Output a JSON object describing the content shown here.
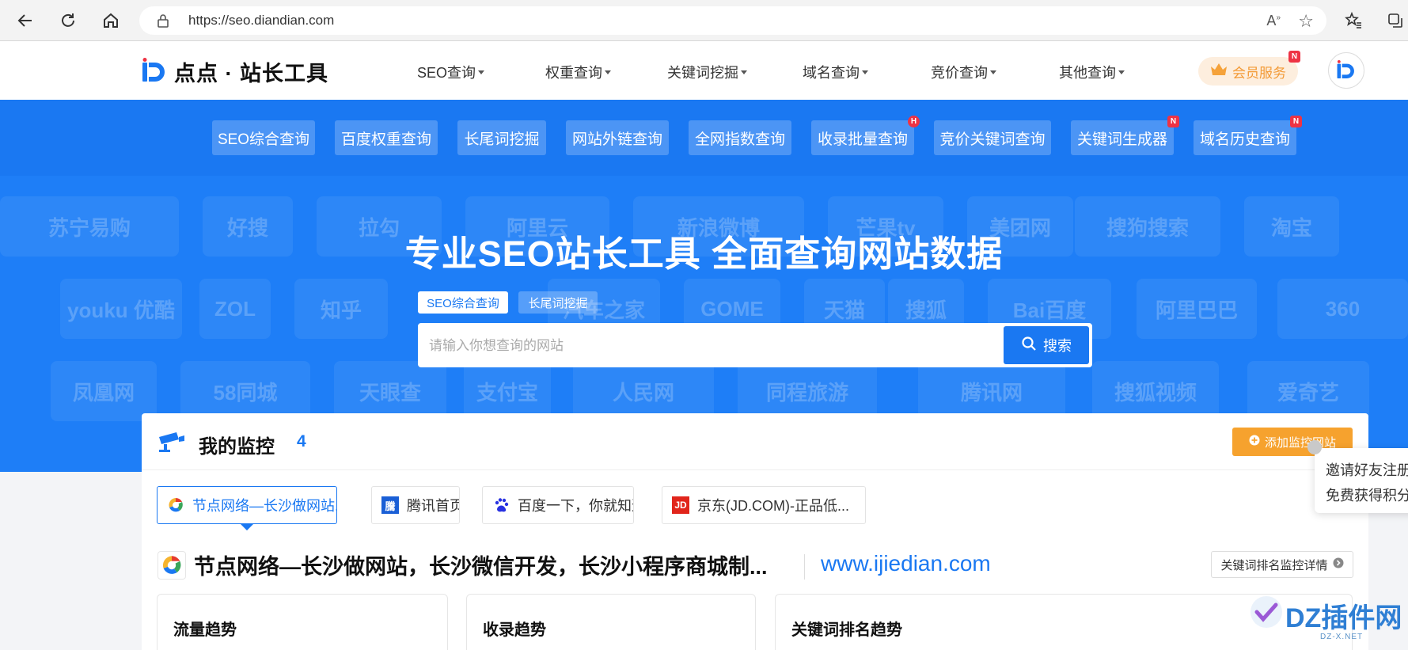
{
  "browser": {
    "url": "https://seo.diandian.com"
  },
  "header": {
    "logo_text": "点点 · 站长工具",
    "nav": [
      {
        "label": "SEO查询"
      },
      {
        "label": "权重查询"
      },
      {
        "label": "关键词挖掘"
      },
      {
        "label": "域名查询"
      },
      {
        "label": "竞价查询"
      },
      {
        "label": "其他查询"
      }
    ],
    "vip_label": "会员服务",
    "vip_badge": "N"
  },
  "quick_links": [
    {
      "label": "SEO综合查询",
      "badge": ""
    },
    {
      "label": "百度权重查询",
      "badge": ""
    },
    {
      "label": "长尾词挖掘",
      "badge": ""
    },
    {
      "label": "网站外链查询",
      "badge": ""
    },
    {
      "label": "全网指数查询",
      "badge": ""
    },
    {
      "label": "收录批量查询",
      "badge": "H"
    },
    {
      "label": "竞价关键词查询",
      "badge": ""
    },
    {
      "label": "关键词生成器",
      "badge": "N"
    },
    {
      "label": "域名历史查询",
      "badge": "N"
    }
  ],
  "background_logos": [
    "苏宁易购",
    "好搜",
    "拉勾",
    "阿里云",
    "新浪微博",
    "芒果tv",
    "美团网",
    "搜狗搜索",
    "淘宝",
    "youku 优酷",
    "ZOL",
    "知乎",
    "汽车之家",
    "GOME",
    "天猫",
    "搜狐",
    "Bai百度",
    "阿里巴巴",
    "360",
    "凤凰网",
    "58同城",
    "天眼查",
    "支付宝",
    "人民网",
    "同程旅游",
    "腾讯网",
    "搜狐视频",
    "爱奇艺"
  ],
  "hero": {
    "title": "专业SEO站长工具 全面查询网站数据",
    "tabs": [
      {
        "label": "SEO综合查询",
        "active": true
      },
      {
        "label": "长尾词挖掘",
        "active": false
      }
    ],
    "search_placeholder": "请输入你想查询的网站",
    "search_button": "搜索"
  },
  "monitor": {
    "title": "我的监控",
    "count": "4",
    "add_button": "添加监控网站",
    "sites": [
      {
        "label": "节点网络—长沙做网站...",
        "active": true
      },
      {
        "label": "腾讯首页",
        "active": false
      },
      {
        "label": "百度一下，你就知道",
        "active": false
      },
      {
        "label": "京东(JD.COM)-正品低...",
        "active": false
      }
    ],
    "site_title": "节点网络—长沙做网站，长沙微信开发，长沙小程序商城制...",
    "site_url": "www.ijiedian.com",
    "detail_button": "关键词排名监控详情",
    "cards": [
      {
        "title": "流量趋势"
      },
      {
        "title": "收录趋势"
      },
      {
        "title": "关键词排名趋势"
      }
    ]
  },
  "invite": {
    "line1": "邀请好友注册",
    "line2": "免费获得积分"
  },
  "watermark": {
    "text": "DZ插件网",
    "sub": "DZ-X.NET"
  },
  "colors": {
    "brand_blue": "#1a78f2",
    "orange": "#f6a22e",
    "badge_red": "#ee3344"
  }
}
